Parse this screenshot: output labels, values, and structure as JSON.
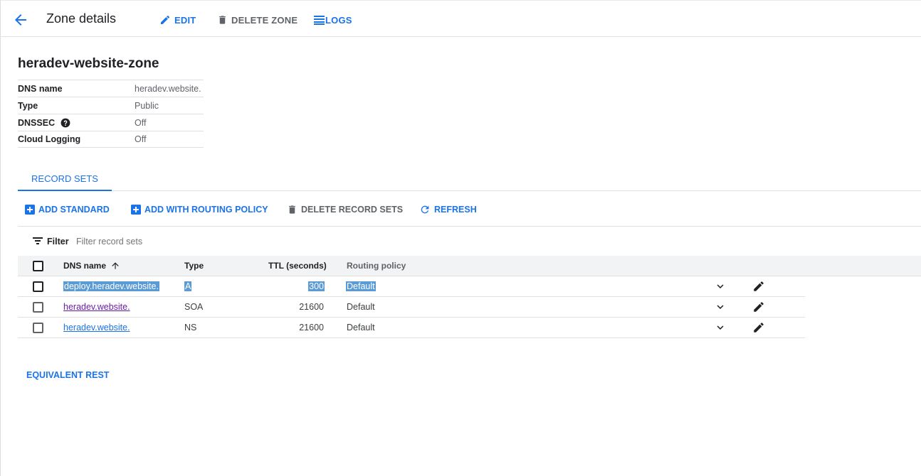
{
  "header": {
    "title": "Zone details",
    "edit_label": "EDIT",
    "delete_zone_label": "DELETE ZONE",
    "logs_label": "LOGS"
  },
  "zone": {
    "name": "heradev-website-zone",
    "details": [
      {
        "key": "DNS name",
        "value": "heradev.website."
      },
      {
        "key": "Type",
        "value": "Public"
      },
      {
        "key": "DNSSEC",
        "value": "Off"
      },
      {
        "key": "Cloud Logging",
        "value": "Off"
      }
    ]
  },
  "tabs": {
    "record_sets": "RECORD SETS"
  },
  "toolbar": {
    "add_standard": "ADD STANDARD",
    "add_routing": "ADD WITH ROUTING POLICY",
    "delete_records": "DELETE RECORD SETS",
    "refresh": "REFRESH"
  },
  "filter": {
    "label": "Filter",
    "placeholder": "Filter record sets"
  },
  "table": {
    "columns": {
      "dns_name": "DNS name",
      "type": "Type",
      "ttl": "TTL (seconds)",
      "routing": "Routing policy"
    },
    "rows": [
      {
        "dns_name": "deploy.heradev.website.",
        "type": "A",
        "ttl": "300",
        "routing": "Default"
      },
      {
        "dns_name": "heradev.website.",
        "type": "SOA",
        "ttl": "21600",
        "routing": "Default"
      },
      {
        "dns_name": "heradev.website.",
        "type": "NS",
        "ttl": "21600",
        "routing": "Default"
      }
    ]
  },
  "footer": {
    "equivalent_rest": "EQUIVALENT REST"
  },
  "colors": {
    "accent": "#1a73e8",
    "selection": "#5b9bd5",
    "visited_link": "#681da8"
  }
}
